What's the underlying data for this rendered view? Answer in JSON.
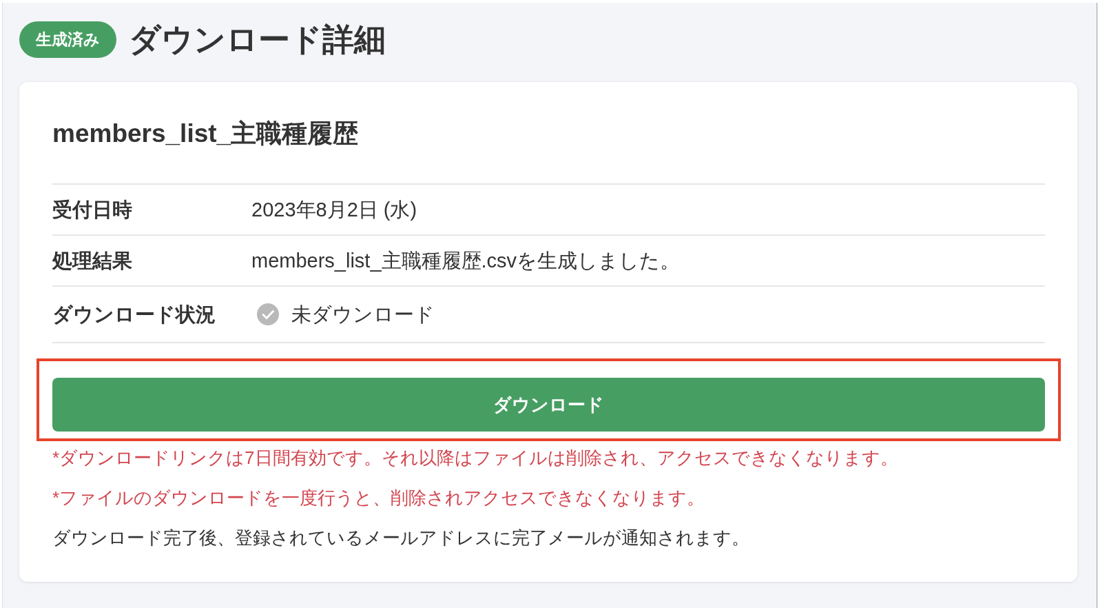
{
  "header": {
    "badge": {
      "label": "生成済み"
    },
    "title": "ダウンロード詳細"
  },
  "card": {
    "title": "members_list_主職種履歴",
    "details": [
      {
        "kind": "text",
        "label": "受付日時",
        "value": "2023年8月2日 (水)"
      },
      {
        "kind": "text",
        "label": "処理結果",
        "value": "members_list_主職種履歴.csvを生成しました。"
      },
      {
        "kind": "status",
        "label": "ダウンロード状況",
        "value": "未ダウンロード",
        "downloaded": false
      }
    ],
    "download_button": {
      "label": "ダウンロード",
      "highlighted": true
    },
    "notes": [
      {
        "kind": "warning",
        "text": "*ダウンロードリンクは7日間有効です。それ以降はファイルは削除され、アクセスできなくなります。"
      },
      {
        "kind": "warning",
        "text": "*ファイルのダウンロードを一度行うと、削除されアクセスできなくなります。"
      },
      {
        "kind": "info",
        "text": "ダウンロード完了後、登録されているメールアドレスに完了メールが通知されます。"
      }
    ]
  }
}
